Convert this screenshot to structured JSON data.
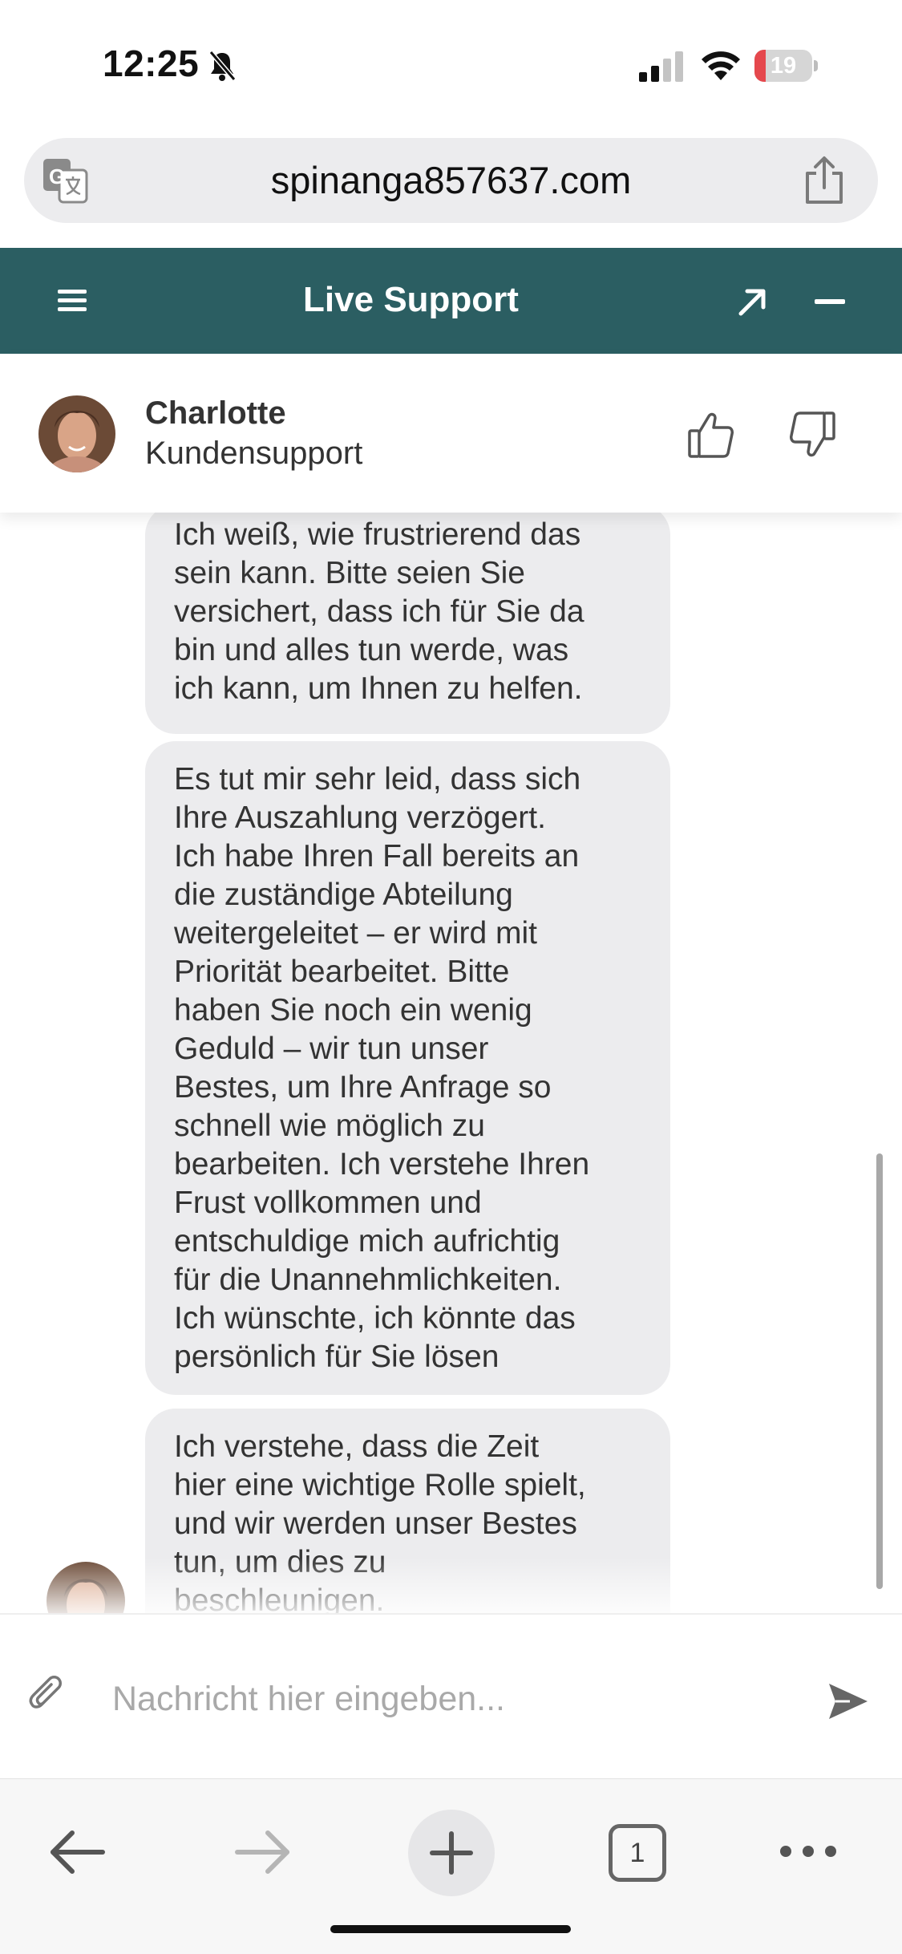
{
  "status_bar": {
    "time": "12:25",
    "battery_level": "19",
    "battery_fraction": 0.19,
    "icons": [
      "bell-off-icon",
      "signal-icon",
      "wifi-icon",
      "battery-icon"
    ]
  },
  "browser": {
    "url": "spinanga857637.com",
    "icons": [
      "translate-icon",
      "share-icon"
    ]
  },
  "chat_header": {
    "title": "Live Support",
    "icons": [
      "menu-icon",
      "expand-icon",
      "minimize-icon"
    ],
    "color": "#2b5e62"
  },
  "agent": {
    "name": "Charlotte",
    "role": "Kundensupport",
    "icons": [
      "thumbs-up-icon",
      "thumbs-down-icon"
    ]
  },
  "messages": [
    {
      "sender": "agent",
      "text": "Ich weiß, wie frustrierend das\nsein kann. Bitte seien Sie\nversichert, dass ich für Sie da\nbin und alles tun werde, was\nich kann, um Ihnen zu helfen."
    },
    {
      "sender": "agent",
      "text": "Es tut mir sehr leid, dass sich\nIhre Auszahlung verzögert.\nIch habe Ihren Fall bereits an\ndie zuständige Abteilung\nweitergeleitet – er wird mit\nPriorität bearbeitet. Bitte\nhaben Sie noch ein wenig\nGeduld – wir tun unser\nBestes, um Ihre Anfrage so\nschnell wie möglich zu\nbearbeiten. Ich verstehe Ihren\nFrust vollkommen und\nentschuldige mich aufrichtig\nfür die Unannehmlichkeiten.\nIch wünschte, ich könnte das\npersönlich für Sie lösen"
    },
    {
      "sender": "agent",
      "text": "Ich verstehe, dass die Zeit\nhier eine wichtige Rolle spielt,\nund wir werden unser Bestes\ntun, um dies zu\nbeschleunigen."
    }
  ],
  "composer": {
    "placeholder": "Nachricht hier eingeben...",
    "icons": [
      "paperclip-icon",
      "send-icon"
    ]
  },
  "toolbar": {
    "tab_count": "1",
    "icons": [
      "back-arrow-icon",
      "forward-arrow-icon",
      "plus-icon",
      "tabs-icon",
      "more-icon"
    ]
  }
}
